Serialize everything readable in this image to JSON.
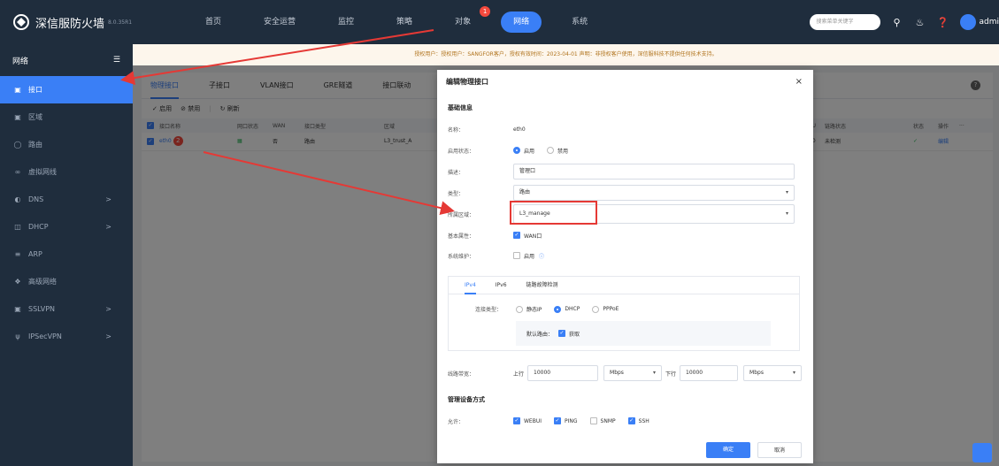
{
  "app": {
    "title": "深信服防火墙",
    "version": "8.0.35R1"
  },
  "nav": [
    {
      "label": "首页",
      "badge": ""
    },
    {
      "label": "安全运营",
      "badge": ""
    },
    {
      "label": "监控",
      "badge": ""
    },
    {
      "label": "策略",
      "badge": ""
    },
    {
      "label": "对象",
      "badge": "1"
    },
    {
      "label": "网络",
      "badge": "",
      "active": true
    },
    {
      "label": "系统",
      "badge": ""
    }
  ],
  "topbar": {
    "search_placeholder": "搜索菜单关键字",
    "user": "admi"
  },
  "sidebar": {
    "title": "网络",
    "items": [
      {
        "label": "接口",
        "icon": "interface-icon",
        "active": true
      },
      {
        "label": "区域",
        "icon": "zone-icon"
      },
      {
        "label": "路由",
        "icon": "route-icon"
      },
      {
        "label": "虚拟网线",
        "icon": "virtual-wire-icon"
      },
      {
        "label": "DNS",
        "icon": "dns-icon",
        "arrow": ">"
      },
      {
        "label": "DHCP",
        "icon": "dhcp-icon",
        "arrow": ">"
      },
      {
        "label": "ARP",
        "icon": "arp-icon"
      },
      {
        "label": "高级网络",
        "icon": "advanced-network-icon"
      },
      {
        "label": "SSLVPN",
        "icon": "sslvpn-icon",
        "arrow": ">"
      },
      {
        "label": "IPSecVPN",
        "icon": "ipsecvpn-icon",
        "arrow": ">"
      }
    ]
  },
  "notice": "授权用户：授权用户：SANGFOR客户，授权有效时间：2023-04-01  声明：非授权客户使用，深信服科技不提供任何技术支持。",
  "tabs": [
    "物理接口",
    "子接口",
    "VLAN接口",
    "GRE隧道",
    "接口联动"
  ],
  "toolbar": {
    "enable": "启用",
    "disable": "禁用",
    "sep": "|",
    "refresh": "刷新"
  },
  "table": {
    "headers": [
      "接口名称",
      "网口状态",
      "WAN",
      "接口类型",
      "区域"
    ],
    "right_headers": [
      "TU",
      "链路状态",
      "状态",
      "操作",
      "···"
    ],
    "row": {
      "name": "eth0",
      "badge": "2",
      "wan": "否",
      "type": "路由",
      "zone": "L3_trust_A",
      "mtu": "00",
      "link": "未检测",
      "status": "✓",
      "action": "编辑"
    }
  },
  "dialog": {
    "title": "编辑物理接口",
    "close": "×",
    "basic_title": "基础信息",
    "name_label": "名称：",
    "name_value": "eth0",
    "enable_label": "启用状态：",
    "enable_on": "启用",
    "enable_off": "禁用",
    "desc_label": "描述：",
    "desc_value": "管理口",
    "type_label": "类型：",
    "type_value": "路由",
    "zone_label": "所属区域：",
    "zone_value": "L3_manage",
    "attr_label": "基本属性：",
    "attr_value": "WAN口",
    "maint_label": "系统维护：",
    "maint_value": "启用",
    "maint_info": "ⓘ",
    "subtabs": [
      "IPv4",
      "IPv6",
      "链路故障检测"
    ],
    "conn_label": "连接类型：",
    "conn_opts": [
      "静态IP",
      "DHCP",
      "PPPoE"
    ],
    "default_route_label": "默认路由：",
    "default_route_value": "获取",
    "bw_label": "线路带宽：",
    "up_label": "上行",
    "up_value": "10000",
    "up_unit": "Mbps",
    "down_label": "下行",
    "down_value": "10000",
    "down_unit": "Mbps",
    "mgmt_title": "管理设备方式",
    "allow_label": "允许：",
    "allow_opts": [
      {
        "label": "WEBUI",
        "checked": true
      },
      {
        "label": "PING",
        "checked": true
      },
      {
        "label": "SNMP",
        "checked": false
      },
      {
        "label": "SSH",
        "checked": true
      }
    ],
    "ok": "确定",
    "cancel": "取消"
  },
  "colors": {
    "accent": "#3a7ff6",
    "sidebar_bg": "#1f2d3d",
    "highlight": "#e53935",
    "badge": "#f5493d"
  }
}
